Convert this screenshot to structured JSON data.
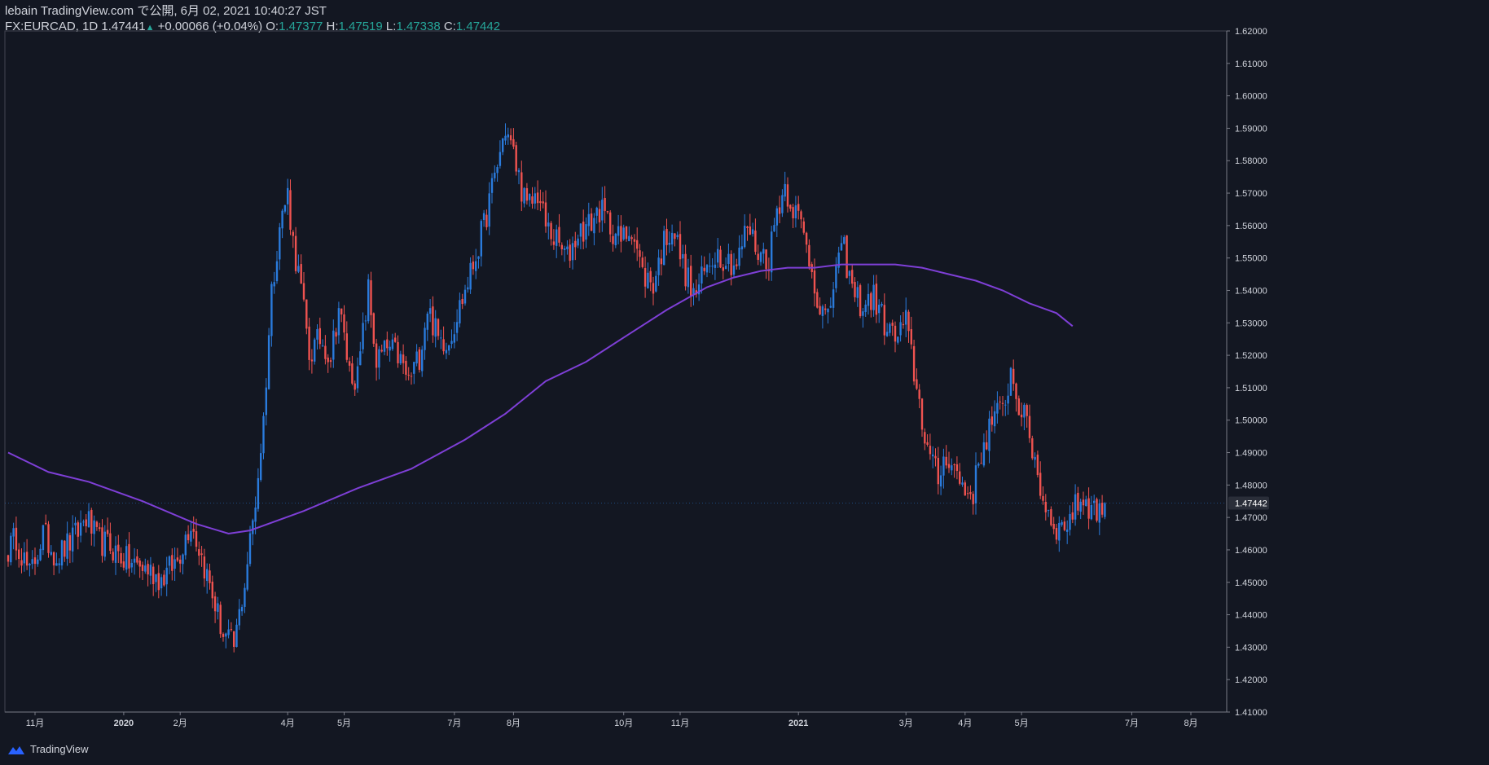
{
  "header": {
    "line1": "lebain TradingView.com で公開, 6月 02, 2021 10:40:27 JST",
    "symbol": "FX:EURCAD, 1D",
    "last": "1.47441",
    "change": "+0.00066 (+0.04%)",
    "o_label": "O:",
    "o_value": "1.47377",
    "h_label": "H:",
    "h_value": "1.47519",
    "l_label": "L:",
    "l_value": "1.47338",
    "c_label": "C:",
    "c_value": "1.47442"
  },
  "branding": {
    "logo_text": "TradingView",
    "logo_icon": "tradingview-cloud-icon"
  },
  "colors": {
    "background": "#131722",
    "up": "#2a7bdc",
    "down": "#ef5350",
    "ma": "#7e3fd6",
    "axis_text": "#d1d4dc",
    "price_tag": "#2a2e39"
  },
  "chart_data": {
    "type": "candlestick",
    "symbol": "FX:EURCAD",
    "interval": "1D",
    "last_price_label": "1.47442",
    "y_ticks": [
      "1.41000",
      "1.42000",
      "1.43000",
      "1.44000",
      "1.45000",
      "1.46000",
      "1.47000",
      "1.48000",
      "1.49000",
      "1.50000",
      "1.51000",
      "1.52000",
      "1.53000",
      "1.54000",
      "1.55000",
      "1.56000",
      "1.57000",
      "1.58000",
      "1.59000",
      "1.60000",
      "1.61000",
      "1.62000"
    ],
    "ylim": [
      1.41,
      1.62
    ],
    "x_ticks": [
      {
        "label": "11月",
        "bold": false,
        "idx": 10
      },
      {
        "label": "2020",
        "bold": true,
        "idx": 43
      },
      {
        "label": "2月",
        "bold": false,
        "idx": 64
      },
      {
        "label": "4月",
        "bold": false,
        "idx": 104
      },
      {
        "label": "5月",
        "bold": false,
        "idx": 125
      },
      {
        "label": "7月",
        "bold": false,
        "idx": 166
      },
      {
        "label": "8月",
        "bold": false,
        "idx": 188
      },
      {
        "label": "10月",
        "bold": false,
        "idx": 229
      },
      {
        "label": "11月",
        "bold": false,
        "idx": 250
      },
      {
        "label": "2021",
        "bold": true,
        "idx": 294
      },
      {
        "label": "3月",
        "bold": false,
        "idx": 334
      },
      {
        "label": "4月",
        "bold": false,
        "idx": 356
      },
      {
        "label": "5月",
        "bold": false,
        "idx": 377
      },
      {
        "label": "7月",
        "bold": false,
        "idx": 418
      },
      {
        "label": "8月",
        "bold": false,
        "idx": 440
      }
    ],
    "close_anchors": [
      [
        0,
        1.46
      ],
      [
        3,
        1.464
      ],
      [
        8,
        1.452
      ],
      [
        13,
        1.465
      ],
      [
        18,
        1.458
      ],
      [
        24,
        1.463
      ],
      [
        29,
        1.47
      ],
      [
        33,
        1.463
      ],
      [
        38,
        1.461
      ],
      [
        45,
        1.456
      ],
      [
        52,
        1.454
      ],
      [
        57,
        1.451
      ],
      [
        63,
        1.457
      ],
      [
        68,
        1.469
      ],
      [
        73,
        1.455
      ],
      [
        80,
        1.434
      ],
      [
        84,
        1.43
      ],
      [
        88,
        1.45
      ],
      [
        92,
        1.475
      ],
      [
        95,
        1.5
      ],
      [
        98,
        1.54
      ],
      [
        101,
        1.56
      ],
      [
        104,
        1.57
      ],
      [
        106,
        1.555
      ],
      [
        109,
        1.54
      ],
      [
        112,
        1.52
      ],
      [
        116,
        1.525
      ],
      [
        120,
        1.52
      ],
      [
        123,
        1.535
      ],
      [
        127,
        1.515
      ],
      [
        130,
        1.513
      ],
      [
        134,
        1.54
      ],
      [
        137,
        1.518
      ],
      [
        141,
        1.522
      ],
      [
        145,
        1.52
      ],
      [
        149,
        1.512
      ],
      [
        153,
        1.52
      ],
      [
        156,
        1.535
      ],
      [
        160,
        1.525
      ],
      [
        164,
        1.525
      ],
      [
        168,
        1.535
      ],
      [
        172,
        1.545
      ],
      [
        177,
        1.56
      ],
      [
        181,
        1.575
      ],
      [
        185,
        1.59
      ],
      [
        187,
        1.585
      ],
      [
        190,
        1.575
      ],
      [
        193,
        1.565
      ],
      [
        197,
        1.57
      ],
      [
        200,
        1.56
      ],
      [
        204,
        1.555
      ],
      [
        208,
        1.55
      ],
      [
        212,
        1.558
      ],
      [
        216,
        1.56
      ],
      [
        220,
        1.565
      ],
      [
        224,
        1.56
      ],
      [
        228,
        1.555
      ],
      [
        232,
        1.56
      ],
      [
        236,
        1.545
      ],
      [
        240,
        1.542
      ],
      [
        244,
        1.555
      ],
      [
        247,
        1.56
      ],
      [
        251,
        1.548
      ],
      [
        255,
        1.538
      ],
      [
        259,
        1.545
      ],
      [
        263,
        1.552
      ],
      [
        267,
        1.55
      ],
      [
        271,
        1.548
      ],
      [
        275,
        1.56
      ],
      [
        279,
        1.552
      ],
      [
        283,
        1.55
      ],
      [
        286,
        1.565
      ],
      [
        289,
        1.572
      ],
      [
        292,
        1.566
      ],
      [
        295,
        1.56
      ],
      [
        298,
        1.55
      ],
      [
        302,
        1.535
      ],
      [
        305,
        1.53
      ],
      [
        308,
        1.548
      ],
      [
        311,
        1.552
      ],
      [
        314,
        1.54
      ],
      [
        318,
        1.535
      ],
      [
        322,
        1.538
      ],
      [
        326,
        1.53
      ],
      [
        330,
        1.525
      ],
      [
        334,
        1.53
      ],
      [
        337,
        1.515
      ],
      [
        340,
        1.5
      ],
      [
        343,
        1.488
      ],
      [
        346,
        1.482
      ],
      [
        349,
        1.49
      ],
      [
        352,
        1.485
      ],
      [
        356,
        1.478
      ],
      [
        359,
        1.478
      ],
      [
        362,
        1.49
      ],
      [
        366,
        1.5
      ],
      [
        370,
        1.503
      ],
      [
        373,
        1.515
      ],
      [
        376,
        1.505
      ],
      [
        379,
        1.498
      ],
      [
        382,
        1.488
      ],
      [
        385,
        1.475
      ],
      [
        388,
        1.47
      ],
      [
        391,
        1.466
      ],
      [
        395,
        1.47
      ],
      [
        399,
        1.476
      ],
      [
        402,
        1.474
      ],
      [
        405,
        1.472
      ],
      [
        408,
        1.474
      ]
    ],
    "ma_points": [
      [
        0,
        1.49
      ],
      [
        15,
        1.484
      ],
      [
        30,
        1.481
      ],
      [
        50,
        1.475
      ],
      [
        70,
        1.468
      ],
      [
        82,
        1.465
      ],
      [
        90,
        1.466
      ],
      [
        110,
        1.472
      ],
      [
        130,
        1.479
      ],
      [
        150,
        1.485
      ],
      [
        170,
        1.494
      ],
      [
        185,
        1.502
      ],
      [
        200,
        1.512
      ],
      [
        215,
        1.518
      ],
      [
        230,
        1.526
      ],
      [
        245,
        1.534
      ],
      [
        260,
        1.541
      ],
      [
        270,
        1.544
      ],
      [
        280,
        1.546
      ],
      [
        290,
        1.547
      ],
      [
        300,
        1.547
      ],
      [
        310,
        1.548
      ],
      [
        320,
        1.548
      ],
      [
        330,
        1.548
      ],
      [
        340,
        1.547
      ],
      [
        350,
        1.545
      ],
      [
        360,
        1.543
      ],
      [
        370,
        1.54
      ],
      [
        380,
        1.536
      ],
      [
        390,
        1.533
      ],
      [
        396,
        1.529
      ]
    ],
    "candle_count": 409
  }
}
